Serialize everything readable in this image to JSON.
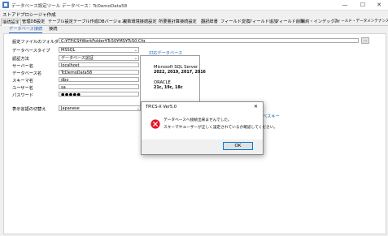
{
  "window": {
    "title": "データベース設定ツール データベース：TcDemoData58",
    "minimize": "—",
    "maximize": "☐",
    "close": "✕"
  },
  "menu": {
    "store_procedure": "ストアドプロシージャ作成"
  },
  "tabs": [
    {
      "label": "接続設定",
      "active": true
    },
    {
      "label": "管理DB設定"
    },
    {
      "label": "テーブル設定"
    },
    {
      "label": "テーブル作成"
    },
    {
      "label": "DBバージョン"
    },
    {
      "label": "複数環境接続設定"
    },
    {
      "label": "所要量計算接続設定"
    },
    {
      "label": "翻訳辞書"
    },
    {
      "label": "フィールド変換"
    },
    {
      "label": "フィールド追加"
    },
    {
      "label": "フィールド削除"
    },
    {
      "label": "制約・インデックス"
    },
    {
      "label": "フィールド・データメンテナンス"
    }
  ],
  "subtabs": [
    {
      "label": "データベース接続",
      "active": true
    },
    {
      "label": "接続"
    }
  ],
  "form": {
    "folder_label": "設定ファイルのフォルダー",
    "folder_value": "C:¥TPiCS¥WorkFolder¥Tc50¥MS¥Tc50.Cfg",
    "browse": "...",
    "dbtype_label": "データベースタイプ",
    "dbtype_value": "MSSQL",
    "auth_label": "認証方法",
    "auth_value": "データベース認証",
    "server_label": "サーバー名",
    "server_value": "localhost",
    "dbname_label": "データベース名",
    "dbname_value": "TcDemoData58",
    "schema_label": "スキーマ名",
    "schema_value": "dbo",
    "user_label": "ユーザー名",
    "user_value": "sa",
    "password_label": "パスワード",
    "password_value": "●●●●●",
    "lang_label": "表示言語の切替え",
    "lang_value": "Japanese"
  },
  "supported": {
    "heading": "対応データベース",
    "ms_name": "Microsoft SQL Server",
    "ms_versions": "2022, 2019, 2017, 2016",
    "oracle_name": "ORACLE",
    "oracle_versions": "21c, 19c, 18c"
  },
  "partial_link": "ベスキー",
  "dialog": {
    "title": "TPiCS-X Ver5.0",
    "close": "✕",
    "line1": "データベースへ接続出来ませんでした。",
    "line2": "スキーマやユーザーが正しく設定されているか確認してください。",
    "ok": "OK",
    "error_icon": "error-x-icon",
    "error_color": "#e81123"
  },
  "colors": {
    "accent": "#1c64c8",
    "ok_border": "#0078d7"
  }
}
